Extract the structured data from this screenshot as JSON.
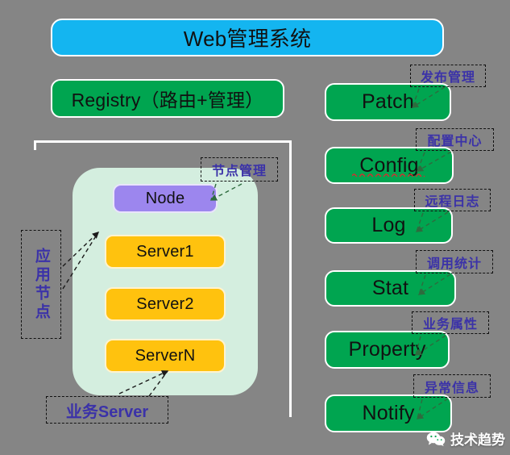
{
  "diagram": {
    "title_box": {
      "label": "Web管理系统"
    },
    "registry_box": {
      "label": "Registry（路由+管理）"
    },
    "app_container": {
      "side_label": "应用节点",
      "bottom_label": "业务Server",
      "node_callout": "节点管理",
      "items": [
        {
          "label": "Node",
          "kind": "node"
        },
        {
          "label": "Server1",
          "kind": "server"
        },
        {
          "label": "Server2",
          "kind": "server"
        },
        {
          "label": "ServerN",
          "kind": "server"
        }
      ]
    },
    "services": [
      {
        "label": "Patch",
        "annotation": "发布管理"
      },
      {
        "label": "Config",
        "annotation": "配置中心"
      },
      {
        "label": "Log",
        "annotation": "远程日志"
      },
      {
        "label": "Stat",
        "annotation": "调用统计"
      },
      {
        "label": "Property",
        "annotation": "业务属性"
      },
      {
        "label": "Notify",
        "annotation": "异常信息"
      }
    ],
    "watermark": {
      "label": "技术趋势",
      "icon": "wechat-icon"
    },
    "colors": {
      "background": "#858585",
      "title": "#14B5F0",
      "service": "#00A550",
      "container": "#D4EEDF",
      "node": "#9C86EE",
      "server": "#FFC20E",
      "annotation_text": "#3B32A8",
      "connector": "#2E6B3E"
    }
  }
}
